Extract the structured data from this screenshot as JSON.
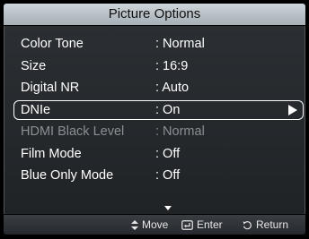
{
  "window": {
    "title": "Picture Options"
  },
  "menu": {
    "items": [
      {
        "label": "Color Tone",
        "value": ": Normal"
      },
      {
        "label": "Size",
        "value": ": 16:9"
      },
      {
        "label": "Digital NR",
        "value": ": Auto"
      },
      {
        "label": "DNIe",
        "value": ": On"
      },
      {
        "label": "HDMI Black Level",
        "value": ": Normal"
      },
      {
        "label": "Film Mode",
        "value": ": Off"
      },
      {
        "label": "Blue Only Mode",
        "value": ": Off"
      }
    ],
    "selected_index": 3,
    "disabled_index": 4
  },
  "footer": {
    "move_label": "Move",
    "enter_label": "Enter",
    "return_label": "Return"
  },
  "icons": {
    "move": "updown-arrows-icon",
    "enter": "enter-icon",
    "return": "return-icon",
    "submenu": "arrow-right-icon",
    "more": "scroll-down-icon"
  },
  "colors": {
    "title_bar": "#b9c1c7",
    "panel": "#24272a",
    "disabled_text": "#8b8f93",
    "text": "#ffffff"
  }
}
